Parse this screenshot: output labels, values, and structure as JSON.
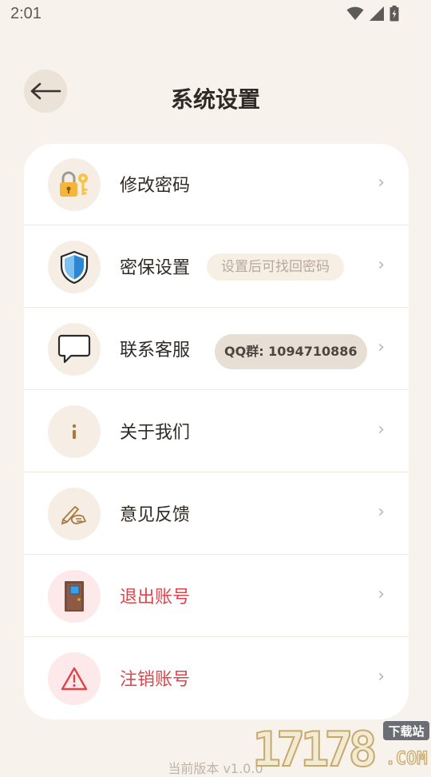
{
  "status_bar": {
    "time": "2:01"
  },
  "header": {
    "title": "系统设置",
    "back_icon": "arrow-left-icon"
  },
  "settings": {
    "items": [
      {
        "label": "修改密码",
        "icon": "lock-key-icon",
        "style": "normal"
      },
      {
        "label": "密保设置",
        "icon": "shield-icon",
        "style": "normal",
        "tag": "设置后可找回密码"
      },
      {
        "label": "联系客服",
        "icon": "chat-bubble-icon",
        "style": "normal",
        "tag": "QQ群: 1094710886"
      },
      {
        "label": "关于我们",
        "icon": "info-icon",
        "style": "normal"
      },
      {
        "label": "意见反馈",
        "icon": "writing-hand-icon",
        "style": "normal"
      },
      {
        "label": "退出账号",
        "icon": "door-icon",
        "style": "danger"
      },
      {
        "label": "注销账号",
        "icon": "warning-icon",
        "style": "danger"
      }
    ],
    "chevron": "›"
  },
  "footer": {
    "version_text": "当前版本 v1.0.0"
  },
  "watermark": {
    "big": "17178",
    "small_top": "下载站",
    "small_bottom": ".COM"
  },
  "colors": {
    "background": "#f7f2ec",
    "card": "#ffffff",
    "danger": "#e0444a",
    "icon_bg": "#f6eee5"
  }
}
